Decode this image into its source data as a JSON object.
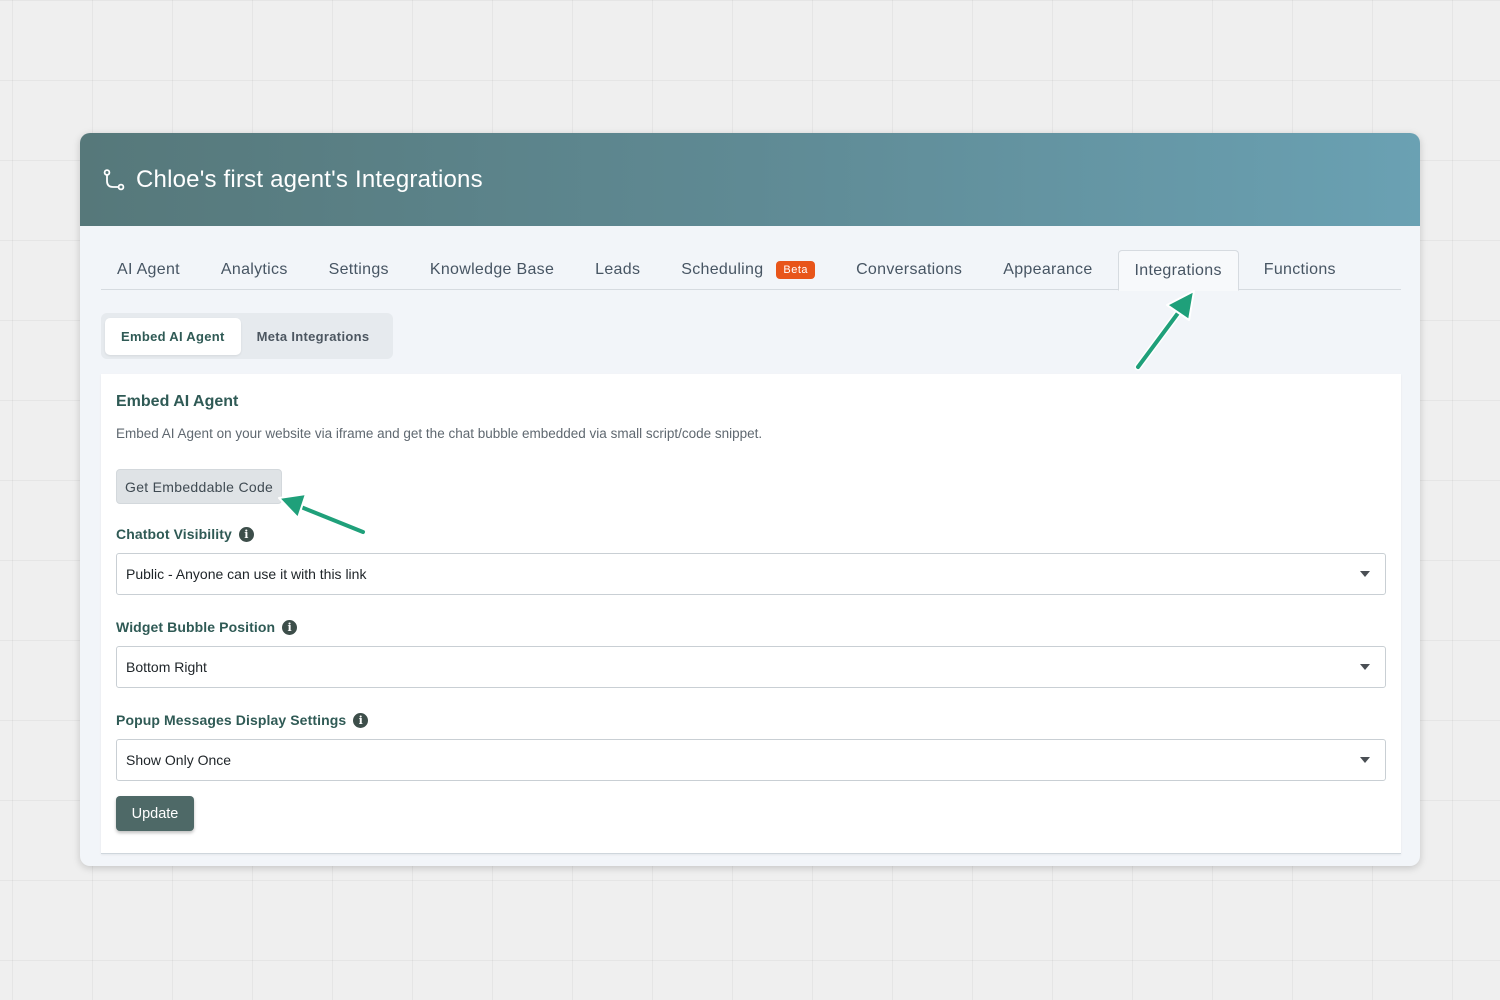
{
  "header": {
    "title": "Chloe's first agent's Integrations",
    "icon": "integration-flow-icon"
  },
  "tabs": [
    {
      "label": "AI Agent"
    },
    {
      "label": "Analytics"
    },
    {
      "label": "Settings"
    },
    {
      "label": "Knowledge Base"
    },
    {
      "label": "Leads"
    },
    {
      "label": "Scheduling",
      "badge": "Beta"
    },
    {
      "label": "Conversations"
    },
    {
      "label": "Appearance"
    },
    {
      "label": "Integrations",
      "active": true
    },
    {
      "label": "Functions"
    }
  ],
  "subtabs": [
    {
      "label": "Embed AI Agent",
      "active": true
    },
    {
      "label": "Meta Integrations"
    }
  ],
  "panel": {
    "title": "Embed AI Agent",
    "description": "Embed AI Agent on your website via iframe and get the chat bubble embedded via small script/code snippet.",
    "embed_button": "Get Embeddable Code",
    "fields": [
      {
        "label": "Chatbot Visibility",
        "value": "Public - Anyone can use it with this link"
      },
      {
        "label": "Widget Bubble Position",
        "value": "Bottom Right"
      },
      {
        "label": "Popup Messages Display Settings",
        "value": "Show Only Once"
      }
    ],
    "update_button": "Update"
  },
  "colors": {
    "accent": "#2f5a55",
    "badge": "#e8551a",
    "arrow": "#1fa07a",
    "update_button": "#4e6967"
  }
}
